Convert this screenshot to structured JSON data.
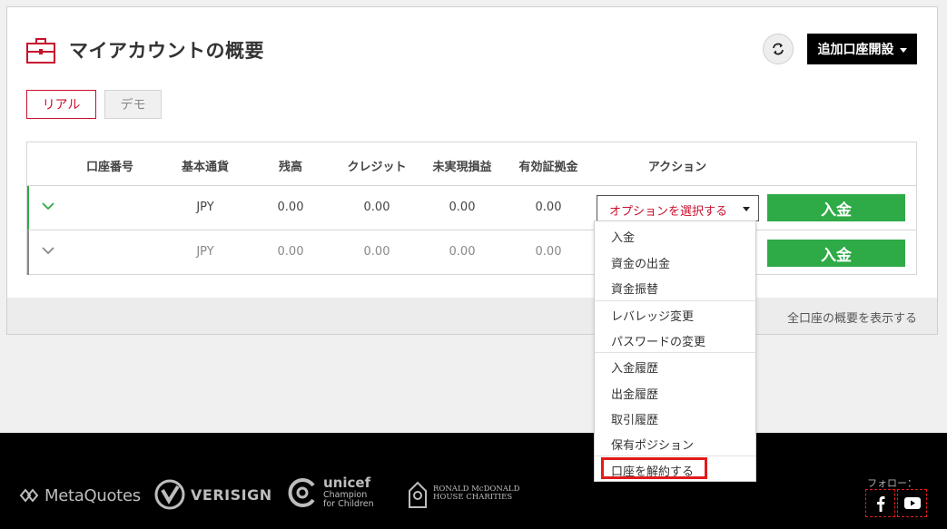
{
  "header": {
    "title": "マイアカウントの概要",
    "add_account_label": "追加口座開設"
  },
  "tabs": [
    {
      "label": "リアル",
      "active": true
    },
    {
      "label": "デモ",
      "active": false
    }
  ],
  "table": {
    "columns": [
      "口座番号",
      "基本通貨",
      "残高",
      "クレジット",
      "未実現損益",
      "有効証拠金",
      "アクション"
    ],
    "rows": [
      {
        "account": "",
        "currency": "JPY",
        "balance": "0.00",
        "credit": "0.00",
        "unrealized": "0.00",
        "equity": "0.00"
      },
      {
        "account": "",
        "currency": "JPY",
        "balance": "0.00",
        "credit": "0.00",
        "unrealized": "0.00",
        "equity": "0.00"
      }
    ],
    "select_label": "オプションを選択する",
    "deposit_label": "入金"
  },
  "dropdown": {
    "items": [
      "入金",
      "資金の出金",
      "資金振替",
      "レバレッジ変更",
      "パスワードの変更",
      "入金履歴",
      "出金履歴",
      "取引履歴",
      "保有ポジション",
      "口座を解約する"
    ]
  },
  "footer_link": "全口座の概要を表示する",
  "footer": {
    "logos": {
      "metaquotes": "MetaQuotes",
      "verisign": "VERISIGN",
      "unicef": "unicef",
      "unicef_sub1": "Champion",
      "unicef_sub2": "for Children",
      "rmhc_line1": "RONALD McDONALD",
      "rmhc_line2": "HOUSE CHARITIES"
    },
    "follow_label": "フォロー："
  },
  "colors": {
    "accent_red": "#c8102e",
    "deposit_green": "#2eaa46",
    "highlight_red": "#e21b1b"
  }
}
